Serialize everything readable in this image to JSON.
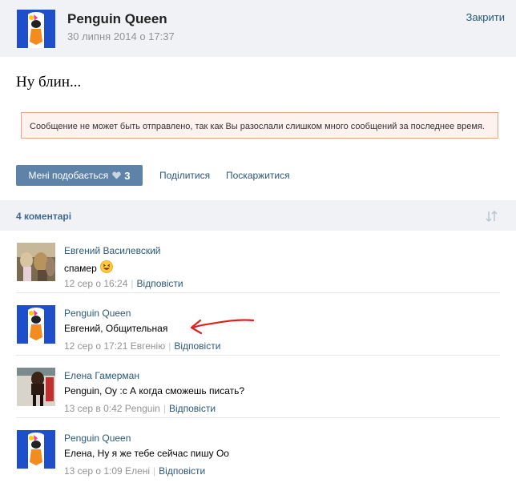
{
  "post": {
    "author": "Penguin Queen",
    "date": "30 липня 2014 о 17:37",
    "close_label": "Закрити",
    "text": "Ну блин...",
    "error_message": "Сообщение не может быть отправлено, так как Вы разослали слишком много сообщений за последнее время."
  },
  "actions": {
    "like_label": "Мені подобається",
    "like_count": "3",
    "share_label": "Поділитися",
    "report_label": "Поскаржитися"
  },
  "comments_header": {
    "count_label": "4 коментарі",
    "sort_icon": "sort-arrows-icon"
  },
  "comments": [
    {
      "author": "Евгений Василевский",
      "text": "спамер",
      "emoji": "laughing-emoji",
      "meta": "12 сер о 16:24",
      "reply_label": "Відповісти",
      "avatar": "photo-avatar"
    },
    {
      "author": "Penguin Queen",
      "text": "Евгений, Общительная",
      "meta": "12 сер о 17:21 Евгенію",
      "reply_label": "Відповісти",
      "avatar": "penguin-avatar"
    },
    {
      "author": "Елена Гамерман",
      "text": "Penguin, Оу :с А когда сможешь писать?",
      "meta": "13 сер в 0:42 Penguin",
      "reply_label": "Відповісти",
      "avatar": "photo-avatar"
    },
    {
      "author": "Penguin Queen",
      "text": "Елена, Ну я же тебе сейчас пишу Оо",
      "meta": "13 сер о 1:09 Елені",
      "reply_label": "Відповісти",
      "avatar": "penguin-avatar"
    }
  ],
  "colors": {
    "link": "#2b587a",
    "header_bg": "#f0f2f5",
    "like_button": "#5e82a8",
    "error_border": "#eca28a",
    "error_bg": "#fdf2ee",
    "annotation_arrow": "#e0201e"
  }
}
